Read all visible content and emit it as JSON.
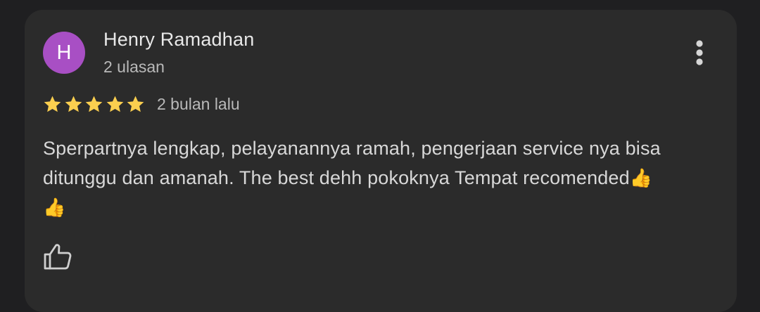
{
  "review": {
    "avatar_initial": "H",
    "author_name": "Henry Ramadhan",
    "review_count": "2 ulasan",
    "rating": 5,
    "rating_max": 5,
    "time_ago": "2 bulan lalu",
    "text": "Sperpartnya lengkap, pelayanannya ramah, pengerjaan service nya bisa ditunggu dan amanah. The best dehh pokoknya Tempat recomended",
    "emoji_1": "👍",
    "emoji_2": "👍"
  },
  "icons": {
    "more": "more-vert-icon",
    "star": "star-icon",
    "like": "thumbs-up-icon"
  },
  "colors": {
    "background": "#1f1f21",
    "card": "#2b2b2b",
    "avatar": "#a84fc4",
    "star": "#fbcf4f",
    "name_text": "#e8e8e8",
    "secondary_text": "#b9b9b9",
    "body_text": "#d8d8d8"
  }
}
